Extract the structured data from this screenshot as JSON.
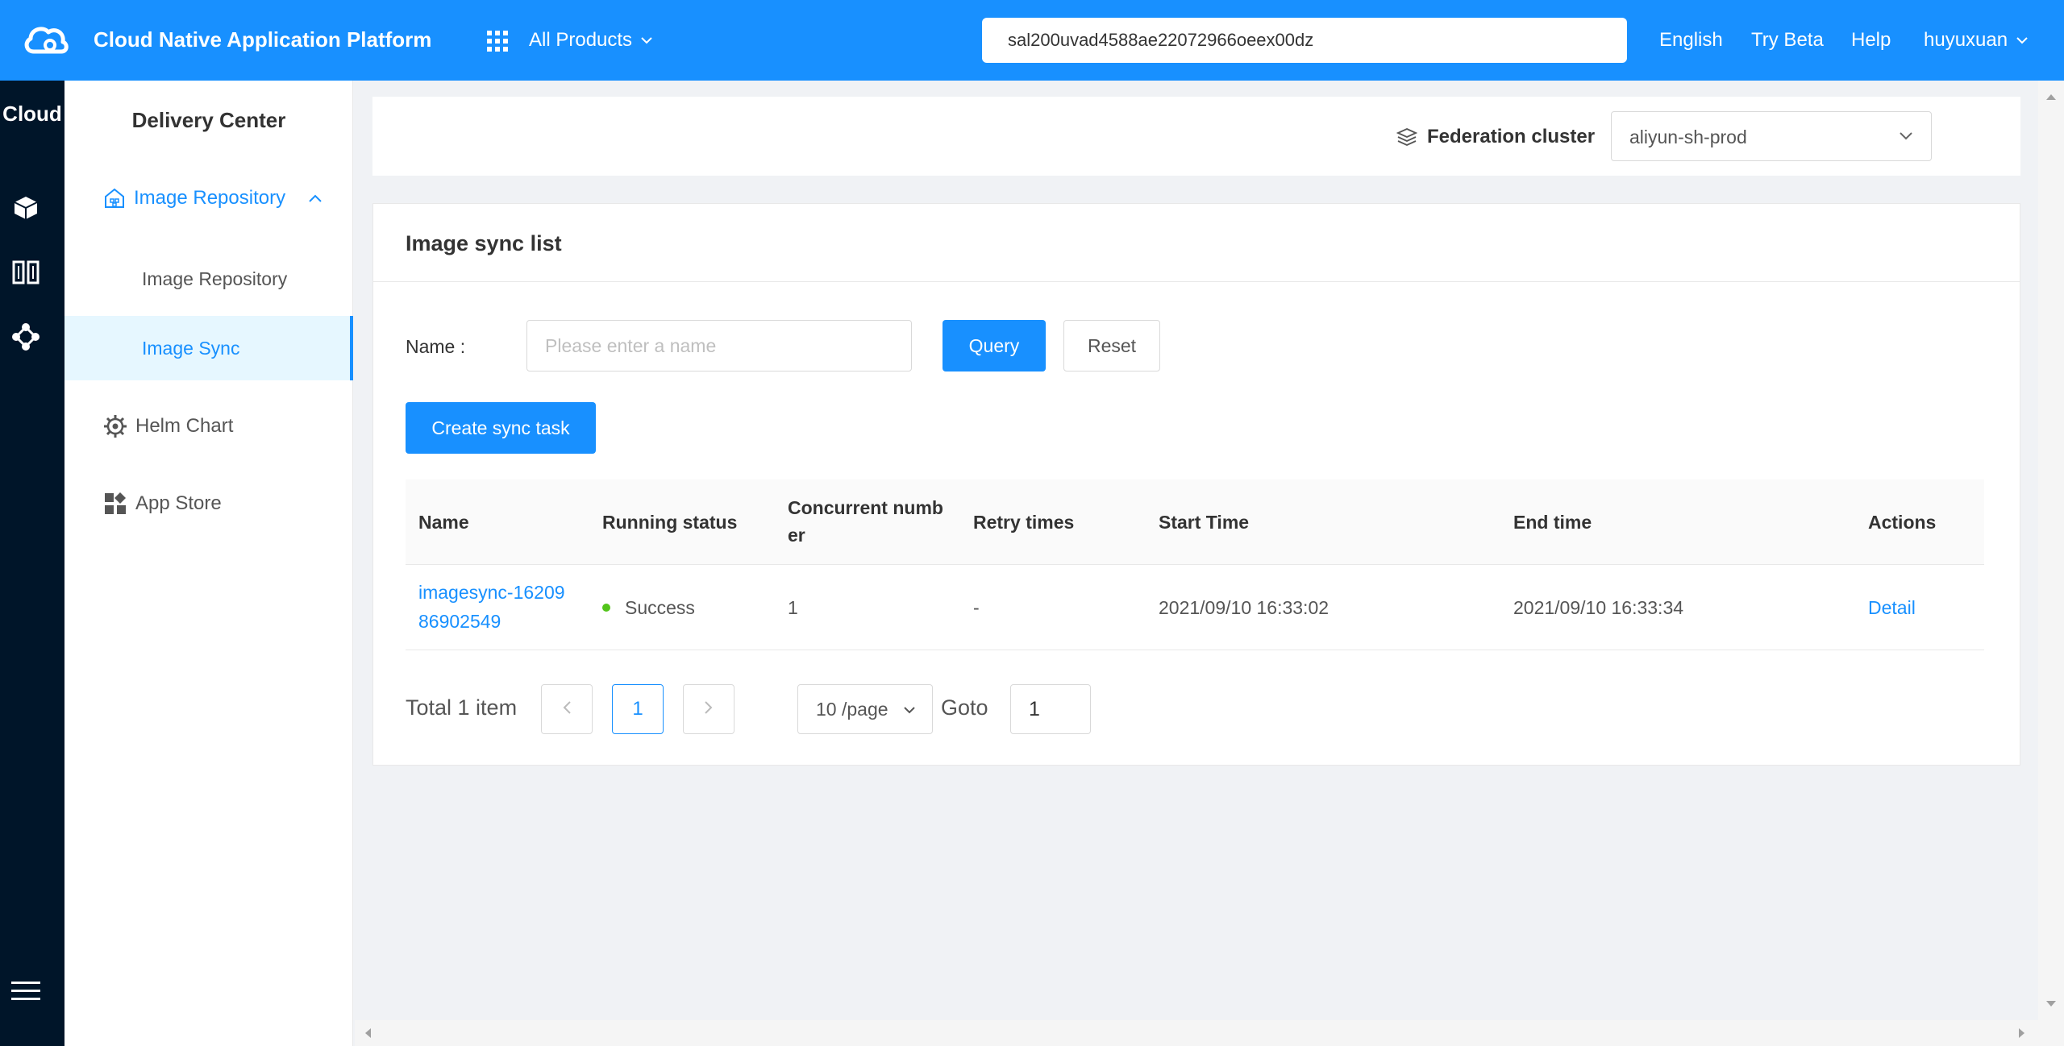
{
  "topbar": {
    "logo_icon": "cloud-logo-icon",
    "title": "Cloud Native Application Platform",
    "products_label": "All Products",
    "search_value": "sal200uvad4588ae22072966oeex00dz",
    "language": "English",
    "try_beta": "Try Beta",
    "help": "Help",
    "user": "huyuxuan"
  },
  "rail": {
    "title": "Cloud",
    "icons": [
      "cube-icon",
      "columns-icon",
      "nodes-icon",
      "menu-icon"
    ]
  },
  "sidebar": {
    "header": "Delivery Center",
    "group_label": "Image Repository",
    "sub_items": [
      "Image Repository",
      "Image Sync"
    ],
    "active_item": "Image Sync",
    "items": [
      "Helm Chart",
      "App Store"
    ]
  },
  "cluster": {
    "label": "Federation cluster",
    "selected": "aliyun-sh-prod"
  },
  "card": {
    "title": "Image sync list",
    "filter_label": "Name :",
    "filter_placeholder": "Please enter a name",
    "query_label": "Query",
    "reset_label": "Reset",
    "create_label": "Create sync task"
  },
  "table": {
    "headers": {
      "name": "Name",
      "status": "Running status",
      "concurrent_1": "Concurrent numb",
      "concurrent_2": "er",
      "retry": "Retry times",
      "start": "Start Time",
      "end": "End time",
      "actions": "Actions"
    },
    "rows": [
      {
        "name_1": "imagesync-16209",
        "name_2": "86902549",
        "status": "Success",
        "concurrent": "1",
        "retry": "-",
        "start": "2021/09/10 16:33:02",
        "end": "2021/09/10 16:33:34",
        "action": "Detail"
      }
    ]
  },
  "pagination": {
    "total": "Total 1 item",
    "current_page": "1",
    "page_size": "10 /page",
    "goto_label": "Goto",
    "goto_value": "1"
  },
  "colors": {
    "primary": "#1890ff",
    "rail": "#001529",
    "success": "#52c41a"
  }
}
